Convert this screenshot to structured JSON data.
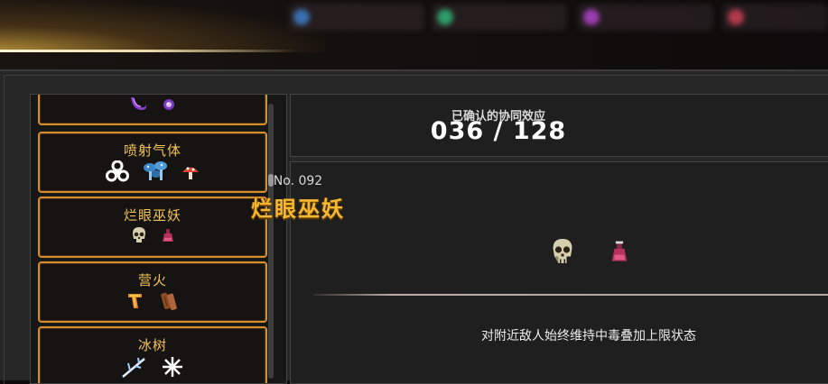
{
  "synergy_counter": {
    "label": "已确认的协同效应",
    "value": "036 / 128"
  },
  "synergy_list": [
    {
      "name": "",
      "icons": [
        "purple-tentacle-icon",
        "purple-orb-icon"
      ]
    },
    {
      "name": "喷射气体",
      "icons": [
        "biohazard-icon",
        "blue-mushroom-cluster-icon",
        "red-mushroom-icon"
      ]
    },
    {
      "name": "烂眼巫妖",
      "icons": [
        "rotten-skull-icon",
        "poison-flask-icon"
      ]
    },
    {
      "name": "营火",
      "icons": [
        "fire-boomerang-icon",
        "firewood-icon"
      ]
    },
    {
      "name": "冰树",
      "icons": [
        "ice-branch-icon",
        "snowflake-icon"
      ]
    }
  ],
  "selected_synergy": {
    "number": "No. 092",
    "name": "烂眼巫妖",
    "icons": [
      "rotten-skull-icon",
      "poison-flask-icon"
    ],
    "description": "对附近敌人始终维持中毒叠加上限状态"
  },
  "colors": {
    "card_border": "#d48e2e",
    "card_title": "#f3c35a",
    "selected_name": "#f7b731",
    "panel_bg": "#1f1f1f"
  }
}
